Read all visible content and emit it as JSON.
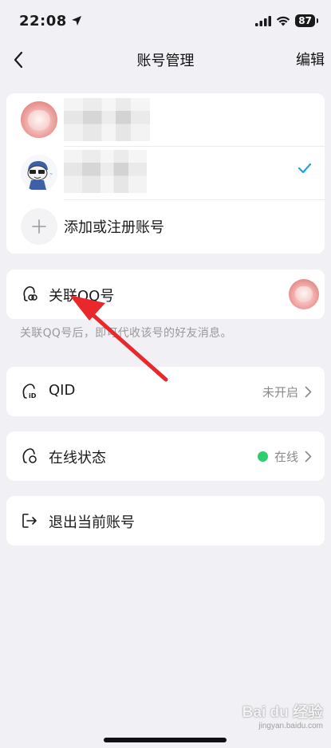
{
  "status_bar": {
    "time": "22:08",
    "battery": "87"
  },
  "nav": {
    "title": "账号管理",
    "edit_label": "编辑"
  },
  "accounts": {
    "add_label": "添加或注册账号"
  },
  "link_qq": {
    "label": "关联QQ号",
    "hint": "关联QQ号后，即可代收该号的好友消息。"
  },
  "qid": {
    "label": "QID",
    "value": "未开启"
  },
  "online_status": {
    "label": "在线状态",
    "value": "在线",
    "dot_color": "#2ccf6b"
  },
  "logout": {
    "label": "退出当前账号"
  },
  "watermark": {
    "brand": "Bai du 经验",
    "sub": "jingyan.baidu.com"
  },
  "colors": {
    "accent": "#1aa3e8",
    "annotation": "#e8282b"
  }
}
